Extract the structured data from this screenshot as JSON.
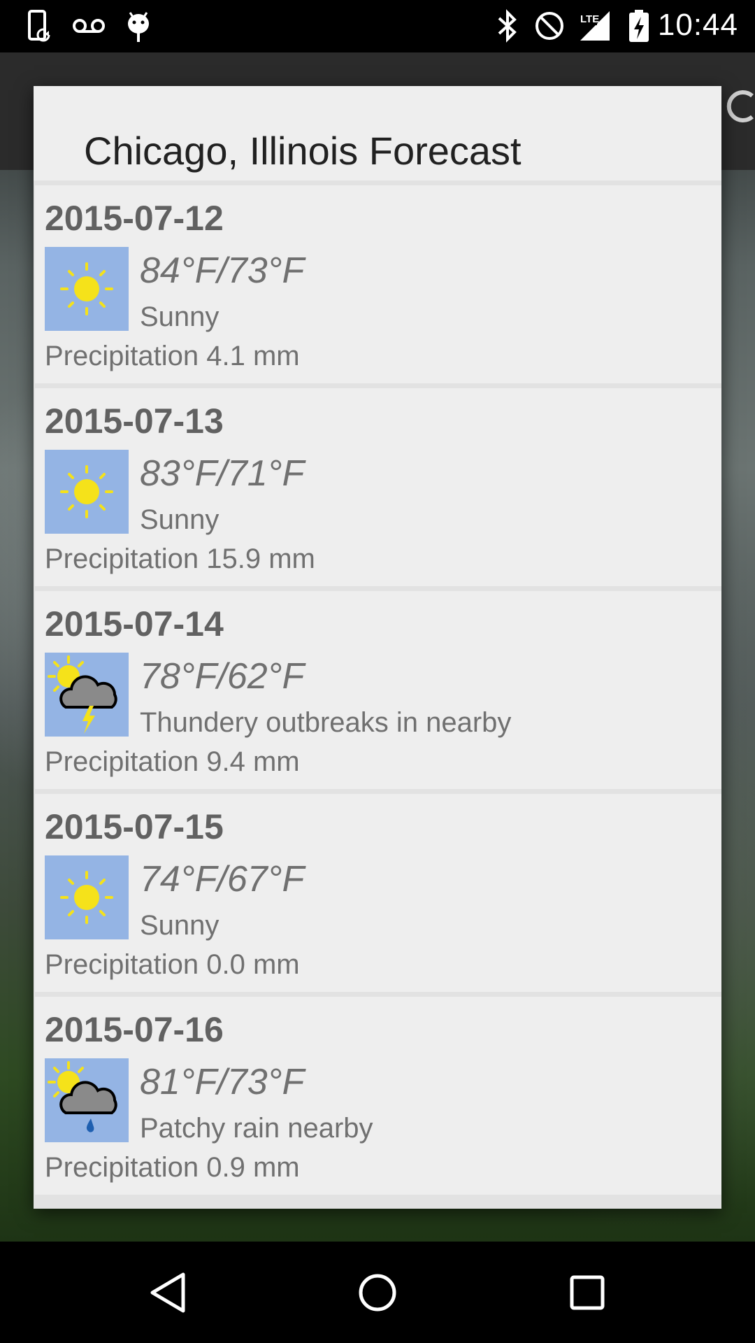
{
  "status_bar": {
    "time": "10:44",
    "icons": [
      "phone-sync-icon",
      "voicemail-icon",
      "android-debug-icon",
      "bluetooth-icon",
      "do-not-disturb-icon",
      "lte-signal-icon",
      "battery-charging-icon"
    ]
  },
  "dialog": {
    "title": "Chicago, Illinois Forecast"
  },
  "forecast": [
    {
      "date": "2015-07-12",
      "temp": "84°F/73°F",
      "condition": "Sunny",
      "precipitation": "Precipitation 4.1 mm",
      "icon": "sunny-icon"
    },
    {
      "date": "2015-07-13",
      "temp": "83°F/71°F",
      "condition": "Sunny",
      "precipitation": "Precipitation 15.9 mm",
      "icon": "sunny-icon"
    },
    {
      "date": "2015-07-14",
      "temp": "78°F/62°F",
      "condition": "Thundery outbreaks in nearby",
      "precipitation": "Precipitation 9.4 mm",
      "icon": "thunder-cloud-icon"
    },
    {
      "date": "2015-07-15",
      "temp": "74°F/67°F",
      "condition": "Sunny",
      "precipitation": "Precipitation 0.0 mm",
      "icon": "sunny-icon"
    },
    {
      "date": "2015-07-16",
      "temp": "81°F/73°F",
      "condition": "Patchy rain nearby",
      "precipitation": "Precipitation 0.9 mm",
      "icon": "rain-cloud-icon"
    }
  ],
  "nav_bar": {
    "buttons": [
      "back-icon",
      "home-icon",
      "recents-icon"
    ]
  },
  "colors": {
    "dialog_bg": "#eeeeee",
    "icon_bg": "#94b4e4",
    "sun": "#f5e21a",
    "text_primary": "#212121",
    "text_secondary": "#707070"
  }
}
